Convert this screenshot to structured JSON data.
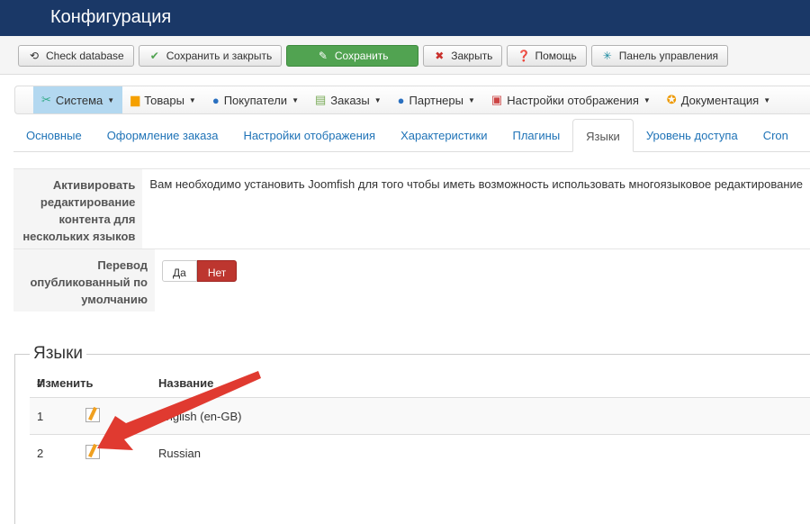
{
  "header": {
    "title": "Конфигурация"
  },
  "toolbar": [
    {
      "label": "Check database",
      "icon": "database-check-icon"
    },
    {
      "label": "Сохранить и закрыть",
      "icon": "check-icon"
    },
    {
      "label": "Сохранить",
      "icon": "edit-icon"
    },
    {
      "label": "Закрыть",
      "icon": "close-icon"
    },
    {
      "label": "Помощь",
      "icon": "help-icon"
    },
    {
      "label": "Панель управления",
      "icon": "joomla-icon"
    }
  ],
  "menu": [
    {
      "label": "Система",
      "icon": "tools-icon"
    },
    {
      "label": "Товары",
      "icon": "box-icon"
    },
    {
      "label": "Покупатели",
      "icon": "user-icon"
    },
    {
      "label": "Заказы",
      "icon": "document-icon"
    },
    {
      "label": "Партнеры",
      "icon": "partner-icon"
    },
    {
      "label": "Настройки отображения",
      "icon": "display-icon"
    },
    {
      "label": "Документация",
      "icon": "lifebuoy-icon"
    }
  ],
  "tabs": [
    "Основные",
    "Оформление заказа",
    "Настройки отображения",
    "Характеристики",
    "Плагины",
    "Языки",
    "Уровень доступа",
    "Cron"
  ],
  "settings": {
    "multilang_label": "Активировать редактирование контента для нескольких языков",
    "multilang_text": "Вам необходимо установить Joomfish для того чтобы иметь возможность использовать многоязыковое редактирование",
    "default_label": "Перевод опубликованный по умолчанию",
    "yes": "Да",
    "no": "Нет",
    "selected": "Нет"
  },
  "languages": {
    "title": "Языки",
    "headers": [
      "#",
      "Изменить",
      "Название"
    ],
    "rows": [
      {
        "n": "1",
        "name": "English (en-GB)"
      },
      {
        "n": "2",
        "name": "Russian"
      }
    ]
  },
  "colors": {
    "header": "#1a3867",
    "save": "#51a351",
    "no": "#bd362f",
    "arrow": "#e03a30"
  }
}
